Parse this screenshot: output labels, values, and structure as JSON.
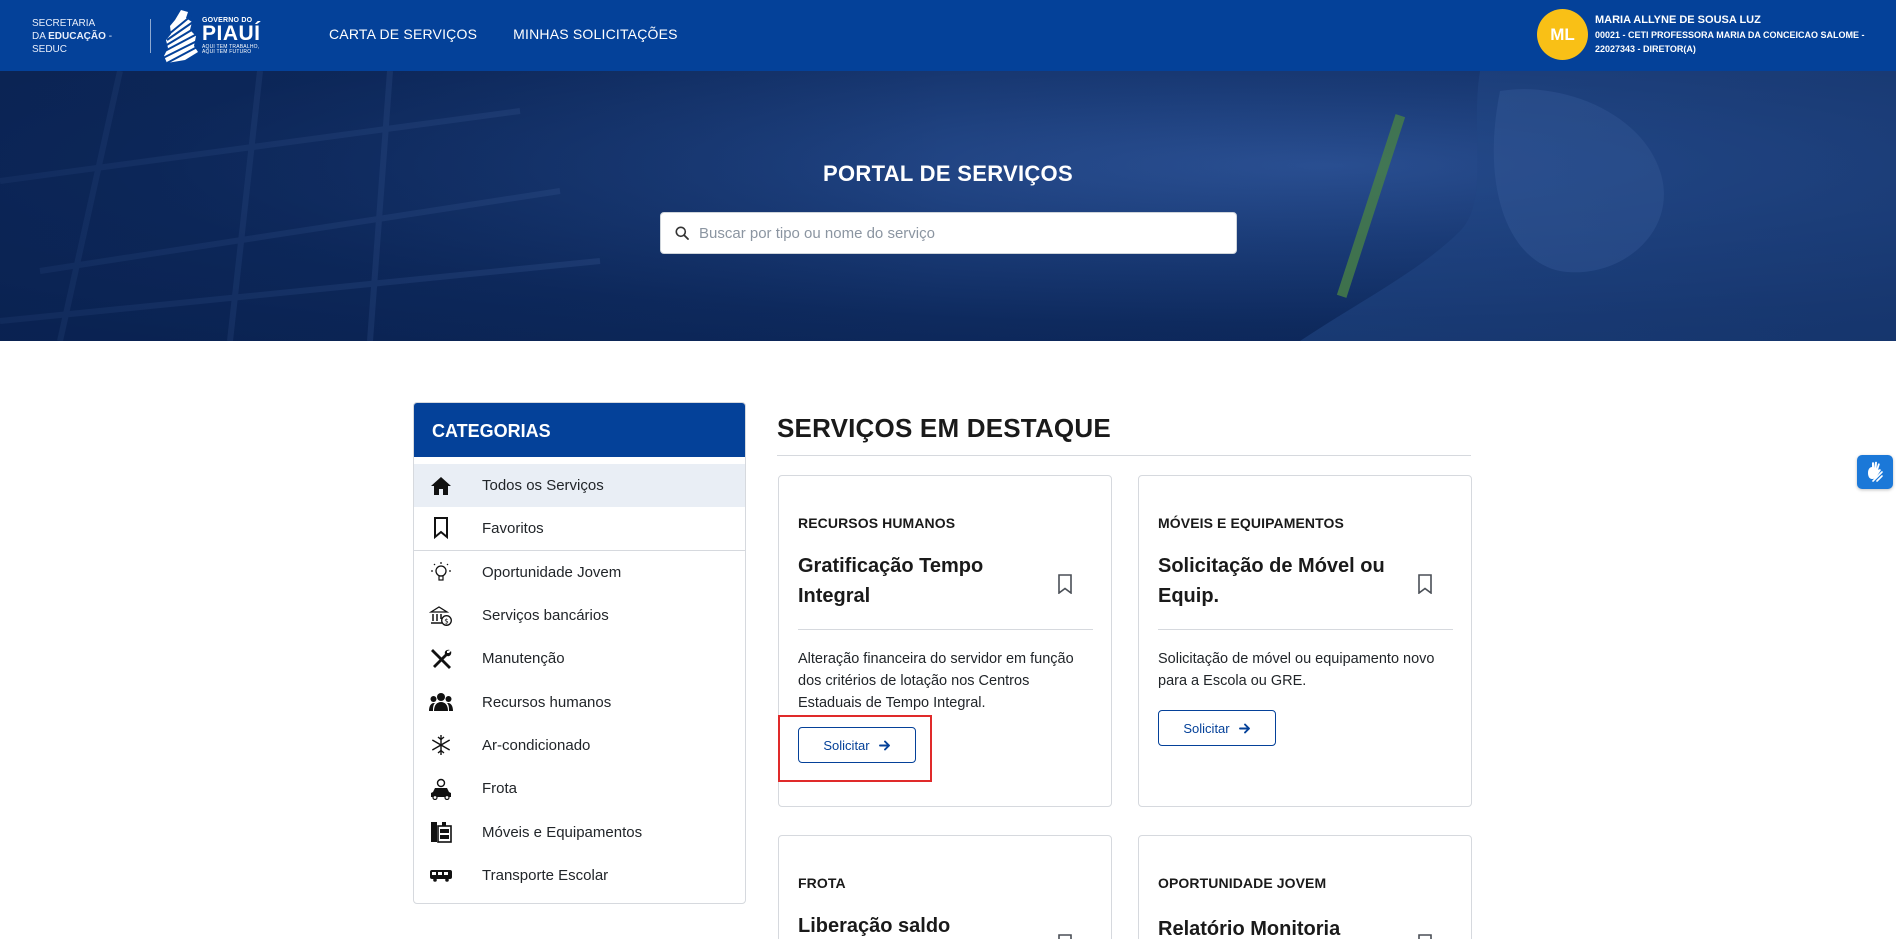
{
  "header": {
    "brand": {
      "secretaria_line1": "SECRETARIA",
      "secretaria_line2a": "DA",
      "secretaria_line2b": "EDUCAÇÃO",
      "secretaria_line2c": "- SEDUC",
      "logo_small": "GOVERNO DO",
      "logo_big": "PIAUÍ",
      "logo_tag1": "AQUI TEM TRABALHO,",
      "logo_tag2": "AQUI TEM FUTURO"
    },
    "nav": [
      "CARTA DE SERVIÇOS",
      "MINHAS SOLICITAÇÕES"
    ],
    "user": {
      "initials": "ML",
      "name": "MARIA ALLYNE DE SOUSA LUZ",
      "detail": "00021 - CETI PROFESSORA MARIA DA CONCEICAO SALOME - 22027343 - DIRETOR(A)"
    }
  },
  "hero": {
    "title": "PORTAL DE SERVIÇOS",
    "search_placeholder": "Buscar por tipo ou nome do serviço",
    "search_value": ""
  },
  "categories": {
    "title": "CATEGORIAS",
    "items": [
      {
        "label": "Todos os Serviços",
        "icon": "home-icon"
      },
      {
        "label": "Favoritos",
        "icon": "bookmark-icon"
      },
      {
        "label": "Oportunidade Jovem",
        "icon": "lightbulb-icon"
      },
      {
        "label": "Serviços bancários",
        "icon": "bank-icon"
      },
      {
        "label": "Manutenção",
        "icon": "tools-icon"
      },
      {
        "label": "Recursos humanos",
        "icon": "people-icon"
      },
      {
        "label": "Ar-condicionado",
        "icon": "snowflake-icon"
      },
      {
        "label": "Frota",
        "icon": "car-icon"
      },
      {
        "label": "Móveis e Equipamentos",
        "icon": "furniture-icon"
      },
      {
        "label": "Transporte Escolar",
        "icon": "bus-icon"
      }
    ]
  },
  "featured": {
    "title": "SERVIÇOS EM DESTAQUE",
    "button_label": "Solicitar",
    "cards": [
      {
        "category": "RECURSOS HUMANOS",
        "title": "Gratificação Tempo Integral",
        "description": "Alteração financeira do servidor em função dos critérios de lotação nos Centros Estaduais de Tempo Integral."
      },
      {
        "category": "MÓVEIS E EQUIPAMENTOS",
        "title": "Solicitação de Móvel ou Equip.",
        "description": "Solicitação de móvel ou equipamento novo para a Escola ou GRE."
      },
      {
        "category": "FROTA",
        "title": "Liberação saldo",
        "description": ""
      },
      {
        "category": "OPORTUNIDADE JOVEM",
        "title": "Relatório Monitoria",
        "description": ""
      }
    ]
  },
  "colors": {
    "primary": "#044199",
    "avatar": "#f9c016",
    "highlight": "#e02a2a",
    "a11y": "#1b78d8"
  }
}
